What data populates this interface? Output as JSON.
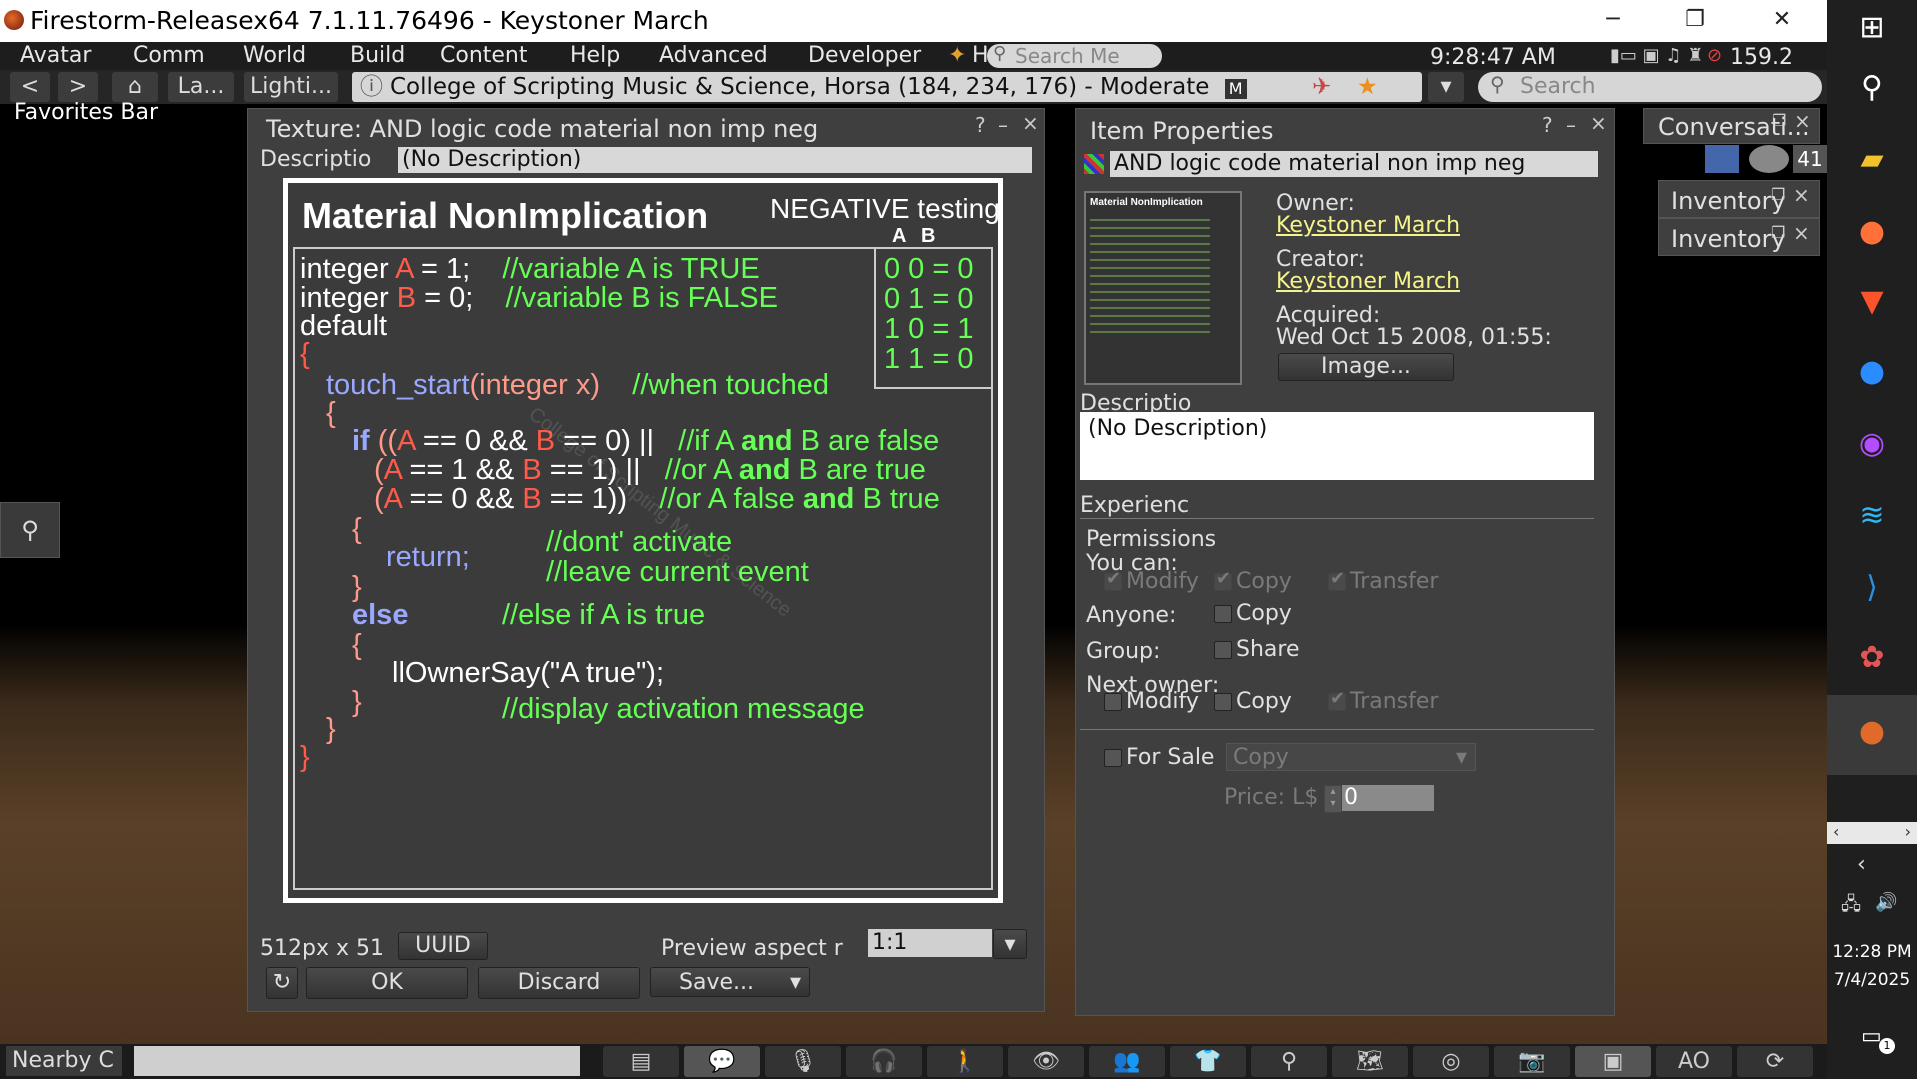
{
  "window": {
    "title": "Firestorm-Releasex64 7.1.11.76496 - Keystoner March",
    "controls": {
      "minimize": "─",
      "restore": "❐",
      "close": "✕"
    }
  },
  "menu": {
    "items": [
      "Avatar",
      "Comm",
      "World",
      "Build",
      "Content",
      "Help",
      "Advanced",
      "Developer"
    ],
    "h_label": "H",
    "search_placeholder": "Search Me",
    "clock": "9:28:47 AM",
    "balance": "159.2"
  },
  "nav": {
    "back": "<",
    "forward": ">",
    "home_icon": "home-icon",
    "landmarks": "La...",
    "lighting": "Lighti...",
    "location": "College of Scripting Music & Science, Horsa (184, 234, 176) - Moderate",
    "maturity_badge": "M",
    "search_placeholder": "Search"
  },
  "favorites_bar": "Favorites Bar",
  "texture_floater": {
    "title": "Texture: AND logic code material non imp neg",
    "help": "?",
    "minimize": "–",
    "close": "×",
    "description_label": "Descriptio",
    "description_value": "(No Description)",
    "size_text": "512px x 51",
    "uuid_button": "UUID",
    "preview_aspect_label": "Preview aspect r",
    "preview_aspect_value": "1:1",
    "ok_button": "OK",
    "discard_button": "Discard",
    "save_button": "Save..."
  },
  "texture_image": {
    "title": "Material NonImplication",
    "subtitle": "NEGATIVE testing",
    "col_a": "A",
    "col_b": "B",
    "truth_table": [
      "0  0 = 0",
      "0  1 = 0",
      "1  0 = 1",
      "1  1 = 0"
    ],
    "watermark": "College of Scripting Music & Science"
  },
  "item_properties": {
    "title": "Item Properties",
    "help": "?",
    "minimize": "–",
    "close": "×",
    "name": "AND logic code material non imp neg",
    "owner_label": "Owner:",
    "owner": "Keystoner March",
    "creator_label": "Creator:",
    "creator": "Keystoner March",
    "acquired_label": "Acquired:",
    "acquired": "Wed Oct 15 2008, 01:55:",
    "image_button": "Image...",
    "description_label": "Descriptio",
    "description_value": "(No Description)",
    "experience_label": "Experienc",
    "permissions_label": "Permissions",
    "you_can_label": "You can:",
    "modify": "Modify",
    "copy": "Copy",
    "transfer": "Transfer",
    "anyone_label": "Anyone:",
    "group_label": "Group:",
    "share": "Share",
    "next_owner_label": "Next owner:",
    "for_sale": "For Sale",
    "sale_type": "Copy",
    "price_label": "Price: L$",
    "price_value": "0"
  },
  "side_floaters": {
    "conversations": "Conversati...",
    "conv_count": "41",
    "inventory1": "Inventory",
    "inventory2": "Inventory"
  },
  "bottom": {
    "nearby_chat": "Nearby C",
    "ao_label": "AO"
  },
  "taskbar": {
    "time": "12:28 PM",
    "date": "7/4/2025",
    "notification_count": "1"
  },
  "colors": {
    "link": "#f5f38a",
    "code_red": "#ff5a4a",
    "code_green": "#66ff55",
    "code_blue": "#9aa8ff"
  }
}
